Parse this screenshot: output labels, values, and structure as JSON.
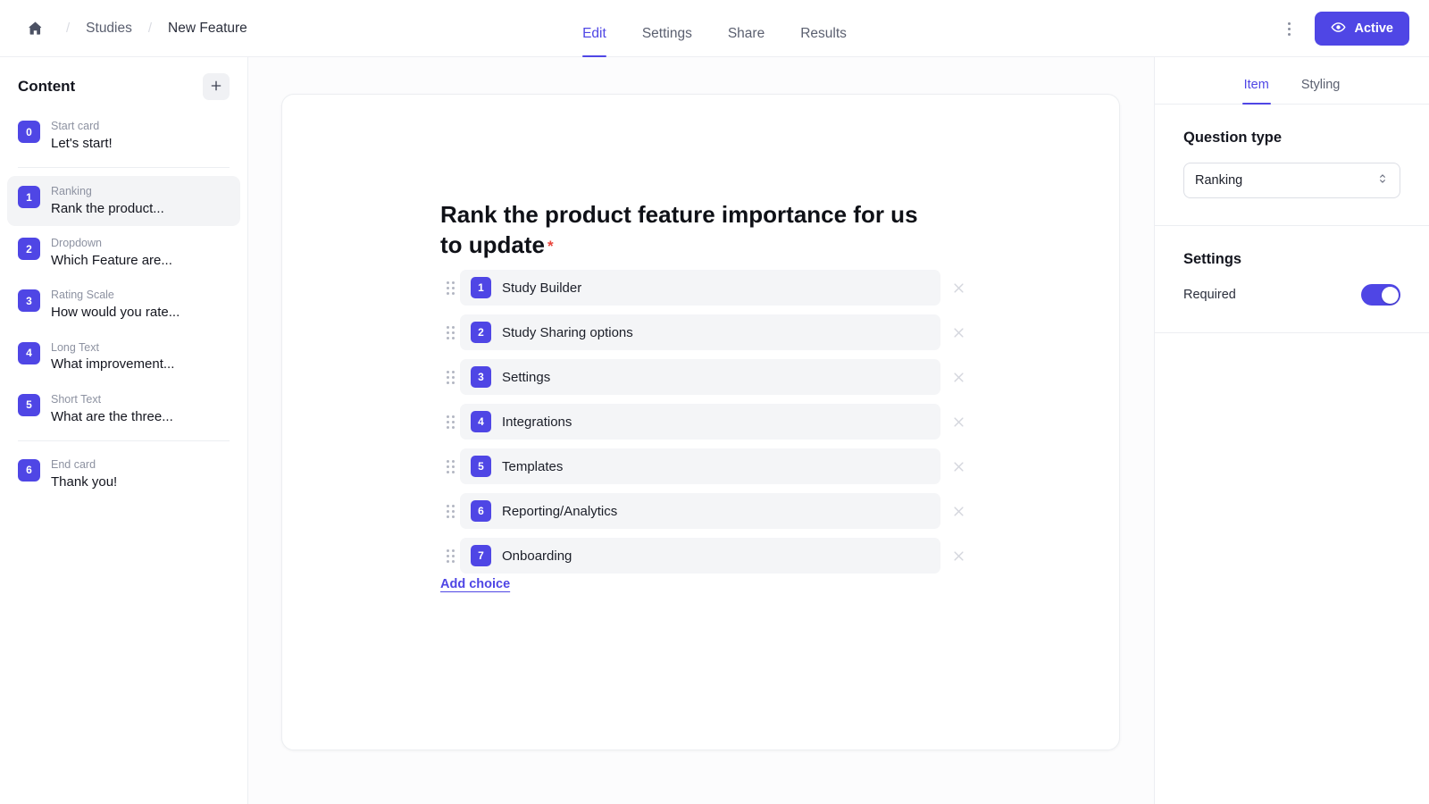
{
  "header": {
    "home_icon": "home-icon",
    "breadcrumb": [
      {
        "label": "Studies"
      },
      {
        "label": "New Feature"
      }
    ],
    "separator": "/",
    "tabs": [
      {
        "label": "Edit",
        "active": true
      },
      {
        "label": "Settings",
        "active": false
      },
      {
        "label": "Share",
        "active": false
      },
      {
        "label": "Results",
        "active": false
      }
    ],
    "kebab_icon": "more-vertical-icon",
    "status_button": {
      "label": "Active",
      "icon": "eye-icon",
      "color": "#4f46e5"
    }
  },
  "sidebar": {
    "title": "Content",
    "add_button_icon": "plus-icon",
    "items": [
      {
        "num": "0",
        "type": "Start card",
        "label": "Let's start!",
        "selected": false
      },
      {
        "num": "1",
        "type": "Ranking",
        "label": "Rank the product...",
        "selected": true
      },
      {
        "num": "2",
        "type": "Dropdown",
        "label": "Which Feature are...",
        "selected": false
      },
      {
        "num": "3",
        "type": "Rating Scale",
        "label": "How would you rate...",
        "selected": false
      },
      {
        "num": "4",
        "type": "Long Text",
        "label": "What improvement...",
        "selected": false
      },
      {
        "num": "5",
        "type": "Short Text",
        "label": "What are the three...",
        "selected": false
      },
      {
        "num": "6",
        "type": "End card",
        "label": "Thank you!",
        "selected": false
      }
    ]
  },
  "canvas": {
    "question_title": "Rank the product feature importance for us to update",
    "required_marker": "*",
    "choices": [
      {
        "num": "1",
        "text": "Study Builder"
      },
      {
        "num": "2",
        "text": "Study Sharing options"
      },
      {
        "num": "3",
        "text": "Settings"
      },
      {
        "num": "4",
        "text": "Integrations"
      },
      {
        "num": "5",
        "text": "Templates"
      },
      {
        "num": "6",
        "text": "Reporting/Analytics"
      },
      {
        "num": "7",
        "text": "Onboarding"
      }
    ],
    "add_choice_label": "Add choice",
    "remove_icon": "close-icon",
    "drag_icon": "drag-handle-icon"
  },
  "right_panel": {
    "tabs": [
      {
        "label": "Item",
        "active": true
      },
      {
        "label": "Styling",
        "active": false
      }
    ],
    "question_type": {
      "heading": "Question type",
      "value": "Ranking",
      "chevron_icon": "chevron-up-down-icon"
    },
    "settings": {
      "heading": "Settings",
      "required_label": "Required",
      "required_on": true
    }
  },
  "colors": {
    "accent": "#4f46e5",
    "required_star": "#e8453c",
    "choice_bg": "#f4f5f7",
    "selected_bg": "#f3f4f6"
  }
}
